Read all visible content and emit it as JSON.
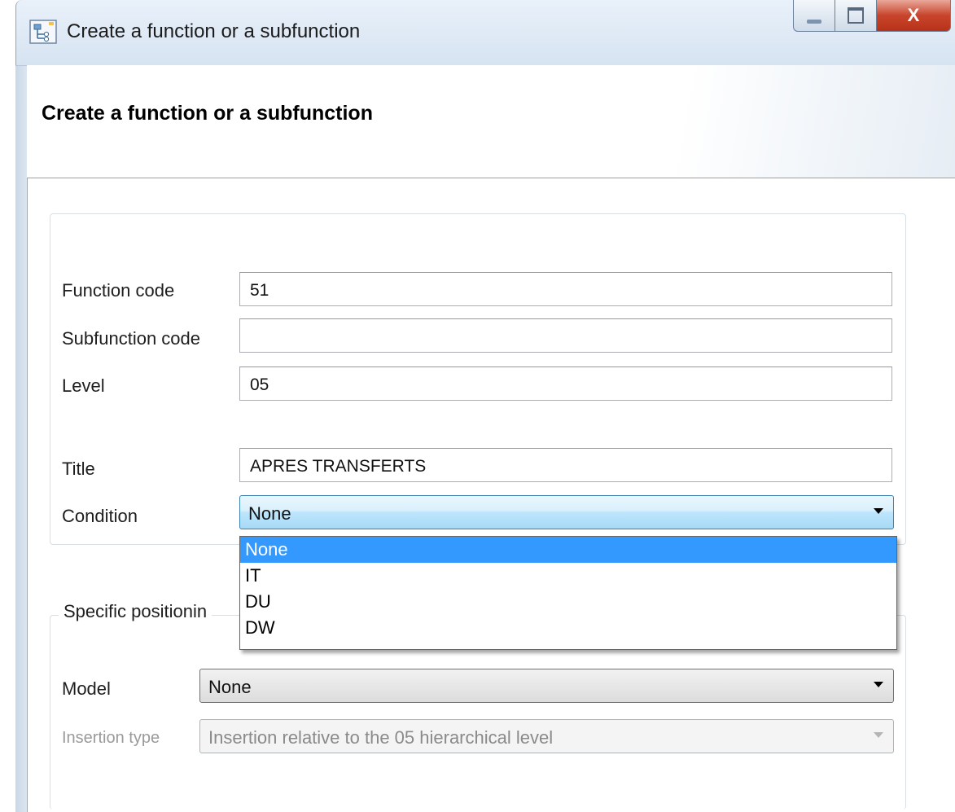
{
  "window": {
    "title": "Create a function or a subfunction",
    "close_glyph": "X"
  },
  "header": {
    "title": "Create a function or a subfunction"
  },
  "form": {
    "function_code_label": "Function code",
    "function_code_value": "51",
    "subfunction_code_label": "Subfunction code",
    "subfunction_code_value": "",
    "level_label": "Level",
    "level_value": "05",
    "title_label": "Title",
    "title_value": "APRES TRANSFERTS",
    "condition_label": "Condition",
    "condition_value": "None",
    "condition_options": [
      "None",
      "IT",
      "DU",
      "DW"
    ],
    "condition_selected": "None"
  },
  "positioning": {
    "legend": "Specific positionin",
    "model_label": "Model",
    "model_value": "None",
    "insertion_type_label": "Insertion type",
    "insertion_type_value": "Insertion relative to the 05 hierarchical level"
  },
  "colors": {
    "selection": "#3399ff",
    "close_button": "#c8442c"
  },
  "icons": {
    "window_icon": "hierarchy-icon",
    "dropdown_arrow": "chevron-down-icon"
  }
}
